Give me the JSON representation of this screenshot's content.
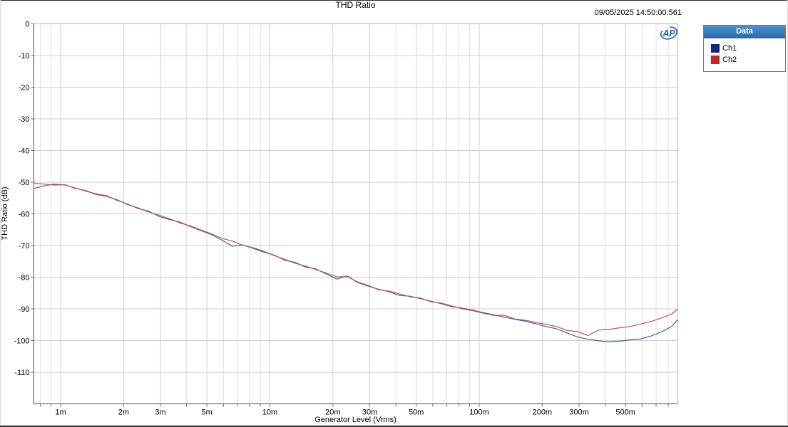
{
  "header": {
    "title": "THD Ratio",
    "timestamp": "09/05/2025 14:50:00.561"
  },
  "legend": {
    "title": "Data",
    "items": [
      {
        "label": "Ch1",
        "color": "#16277e"
      },
      {
        "label": "Ch2",
        "color": "#c32524"
      }
    ]
  },
  "icons": {
    "logo": "ap-logo"
  },
  "colors": {
    "accent_blue": "#2e75b6",
    "logo_blue": "#2263a8",
    "grid_major": "#cfcfcf",
    "grid_minor": "#e0e0e0",
    "frame_dark": "#4d4d4d",
    "frame_light": "#b6b6b6",
    "tick": "#6e6e6e",
    "ch1_line": "#3e5fa7",
    "ch2_line": "#c4504b"
  },
  "chart_data": {
    "type": "line",
    "title": "THD Ratio",
    "xlabel": "Generator Level (Vrms)",
    "ylabel": "THD Ratio (dB)",
    "x_scale": "log",
    "x_unit": "mVrms",
    "xlim_mV": [
      0.74,
      886
    ],
    "ylim": [
      -120,
      0
    ],
    "grid": true,
    "legend_position": "top-right-outside",
    "y_tick_values": [
      0,
      -10,
      -20,
      -30,
      -40,
      -50,
      -60,
      -70,
      -80,
      -90,
      -100,
      -110
    ],
    "y_tick_labels": [
      "0",
      "-10",
      "-20",
      "-30",
      "-40",
      "-50",
      "-60",
      "-70",
      "-80",
      "-90",
      "-100",
      "-110"
    ],
    "x_major_tick_values_mV": [
      1,
      2,
      3,
      5,
      10,
      20,
      30,
      50,
      100,
      200,
      300,
      500
    ],
    "x_major_tick_labels": [
      "1m",
      "2m",
      "3m",
      "5m",
      "10m",
      "20m",
      "30m",
      "50m",
      "100m",
      "200m",
      "300m",
      "500m"
    ],
    "x_minor_tick_values_mV": [
      0.8,
      0.9,
      4,
      6,
      7,
      8,
      9,
      40,
      60,
      70,
      80,
      90,
      400,
      600,
      700,
      800
    ],
    "x_mV": [
      0.74,
      0.83,
      0.93,
      1.05,
      1.17,
      1.32,
      1.48,
      1.66,
      1.86,
      2.09,
      2.34,
      2.63,
      2.95,
      3.31,
      3.72,
      4.17,
      4.68,
      5.25,
      5.89,
      6.61,
      7.41,
      8.32,
      9.33,
      10.5,
      11.7,
      13.2,
      14.8,
      16.6,
      18.6,
      20.9,
      23.4,
      26.3,
      29.5,
      33.1,
      37.2,
      41.7,
      46.8,
      52.5,
      58.9,
      66.1,
      74.1,
      83.2,
      93.3,
      104.7,
      117.5,
      131.8,
      147.9,
      166,
      186.2,
      208.9,
      234.4,
      263,
      295.1,
      331.1,
      371.5,
      416.9,
      467.7,
      524.8,
      588.8,
      660.7,
      741.3,
      831.8,
      885
    ],
    "series": [
      {
        "name": "Ch1",
        "color": "#3e5fa7",
        "values": [
          -52.0,
          -51.2,
          -50.6,
          -50.9,
          -51.8,
          -52.8,
          -53.7,
          -54.3,
          -55.7,
          -56.9,
          -58.3,
          -59.1,
          -60.8,
          -61.8,
          -62.6,
          -64.0,
          -65.3,
          -66.5,
          -68.3,
          -70.2,
          -69.8,
          -70.9,
          -72.1,
          -73.0,
          -74.6,
          -75.3,
          -76.8,
          -77.4,
          -79.0,
          -80.6,
          -79.6,
          -81.7,
          -82.8,
          -83.8,
          -84.6,
          -85.8,
          -86.0,
          -86.8,
          -87.6,
          -88.4,
          -89.3,
          -89.8,
          -90.4,
          -91.2,
          -91.9,
          -92.6,
          -93.3,
          -93.9,
          -94.7,
          -95.6,
          -96.3,
          -97.6,
          -98.9,
          -99.6,
          -100.1,
          -100.4,
          -100.2,
          -99.8,
          -99.5,
          -98.6,
          -97.3,
          -95.5,
          -93.5
        ]
      },
      {
        "name": "Ch2",
        "color": "#c4504b",
        "values": [
          -50.3,
          -50.6,
          -50.9,
          -50.8,
          -51.9,
          -52.6,
          -53.9,
          -54.5,
          -55.5,
          -57.1,
          -58.1,
          -59.4,
          -60.4,
          -61.5,
          -62.9,
          -63.8,
          -65.1,
          -66.3,
          -67.7,
          -68.6,
          -69.9,
          -70.7,
          -71.8,
          -73.2,
          -74.3,
          -75.6,
          -76.5,
          -77.6,
          -78.7,
          -79.9,
          -79.8,
          -81.5,
          -82.6,
          -84.0,
          -84.4,
          -85.3,
          -86.2,
          -86.6,
          -87.8,
          -88.2,
          -89.1,
          -90.0,
          -90.6,
          -91.4,
          -92.1,
          -92.0,
          -93.2,
          -93.6,
          -94.3,
          -94.9,
          -95.6,
          -96.8,
          -97.2,
          -98.4,
          -96.7,
          -96.5,
          -96.0,
          -95.6,
          -94.8,
          -94.0,
          -92.9,
          -91.6,
          -90.2
        ]
      }
    ]
  }
}
